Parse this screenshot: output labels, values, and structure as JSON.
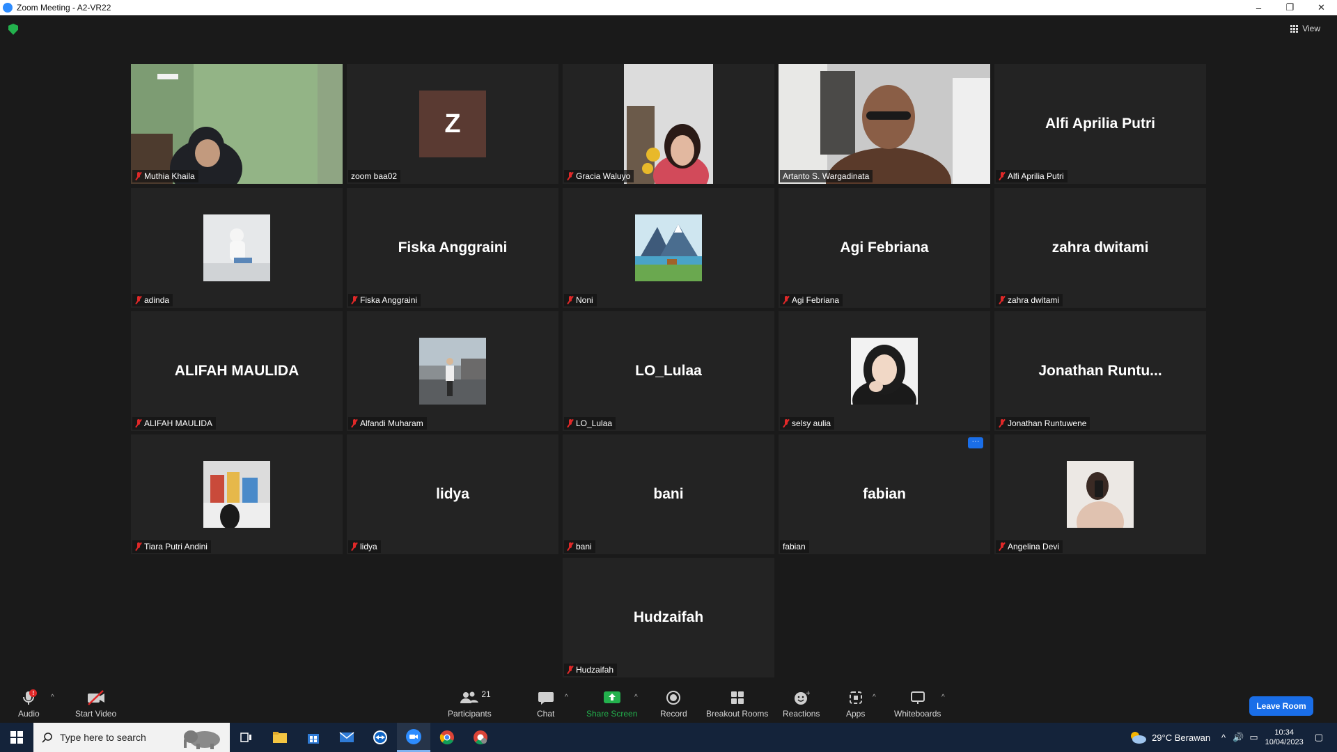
{
  "window": {
    "title": "Zoom Meeting - A2-VR22",
    "minimize": "–",
    "restore": "❐",
    "close": "✕"
  },
  "top_bar": {
    "view_label": "View"
  },
  "participants": [
    {
      "name": "Muthia Khaila",
      "display": "",
      "muted": true,
      "kind": "video"
    },
    {
      "name": "zoom baa02",
      "display": "Z",
      "muted": false,
      "kind": "initial"
    },
    {
      "name": "Gracia Waluyo",
      "display": "",
      "muted": true,
      "kind": "video"
    },
    {
      "name": "Artanto S. Wargadinata",
      "display": "",
      "muted": false,
      "kind": "video",
      "active_speaker": true
    },
    {
      "name": "Alfi Aprilia Putri",
      "display": "Alfi Aprilia Putri",
      "muted": true,
      "kind": "name"
    },
    {
      "name": "adinda",
      "display": "",
      "muted": true,
      "kind": "photo"
    },
    {
      "name": "Fiska Anggraini",
      "display": "Fiska Anggraini",
      "muted": true,
      "kind": "name"
    },
    {
      "name": "Noni",
      "display": "",
      "muted": true,
      "kind": "photo"
    },
    {
      "name": "Agi Febriana",
      "display": "Agi Febriana",
      "muted": true,
      "kind": "name"
    },
    {
      "name": "zahra dwitami",
      "display": "zahra dwitami",
      "muted": true,
      "kind": "name"
    },
    {
      "name": "ALIFAH MAULIDA",
      "display": "ALIFAH MAULIDA",
      "muted": true,
      "kind": "name"
    },
    {
      "name": "Alfandi Muharam",
      "display": "",
      "muted": true,
      "kind": "photo"
    },
    {
      "name": "LO_Lulaa",
      "display": "LO_Lulaa",
      "muted": true,
      "kind": "name"
    },
    {
      "name": "selsy aulia",
      "display": "",
      "muted": true,
      "kind": "photo"
    },
    {
      "name": "Jonathan Runtuwene",
      "display": "Jonathan  Runtu...",
      "muted": true,
      "kind": "name"
    },
    {
      "name": "Tiara Putri Andini",
      "display": "",
      "muted": true,
      "kind": "photo"
    },
    {
      "name": "lidya",
      "display": "lidya",
      "muted": true,
      "kind": "name"
    },
    {
      "name": "bani",
      "display": "bani",
      "muted": true,
      "kind": "name"
    },
    {
      "name": "fabian",
      "display": "fabian",
      "muted": false,
      "kind": "name",
      "menu": "···"
    },
    {
      "name": "Angelina Devi",
      "display": "",
      "muted": true,
      "kind": "photo"
    },
    {
      "name": "Hudzaifah",
      "display": "Hudzaifah",
      "muted": true,
      "kind": "name"
    }
  ],
  "toolbar": {
    "audio": "Audio",
    "audio_badge": "!",
    "start_video": "Start Video",
    "participants": "Participants",
    "participants_count": "21",
    "chat": "Chat",
    "share_screen": "Share Screen",
    "record": "Record",
    "breakout_rooms": "Breakout Rooms",
    "reactions": "Reactions",
    "apps": "Apps",
    "whiteboards": "Whiteboards",
    "leave": "Leave Room"
  },
  "taskbar": {
    "search_placeholder": "Type here to search",
    "weather": "29°C  Berawan",
    "time": "10:34",
    "date": "10/04/2023"
  },
  "colors": {
    "accent": "#1a6ee8",
    "active_speaker": "#d6e86a",
    "muted": "#e02828",
    "share": "#23b14d"
  }
}
